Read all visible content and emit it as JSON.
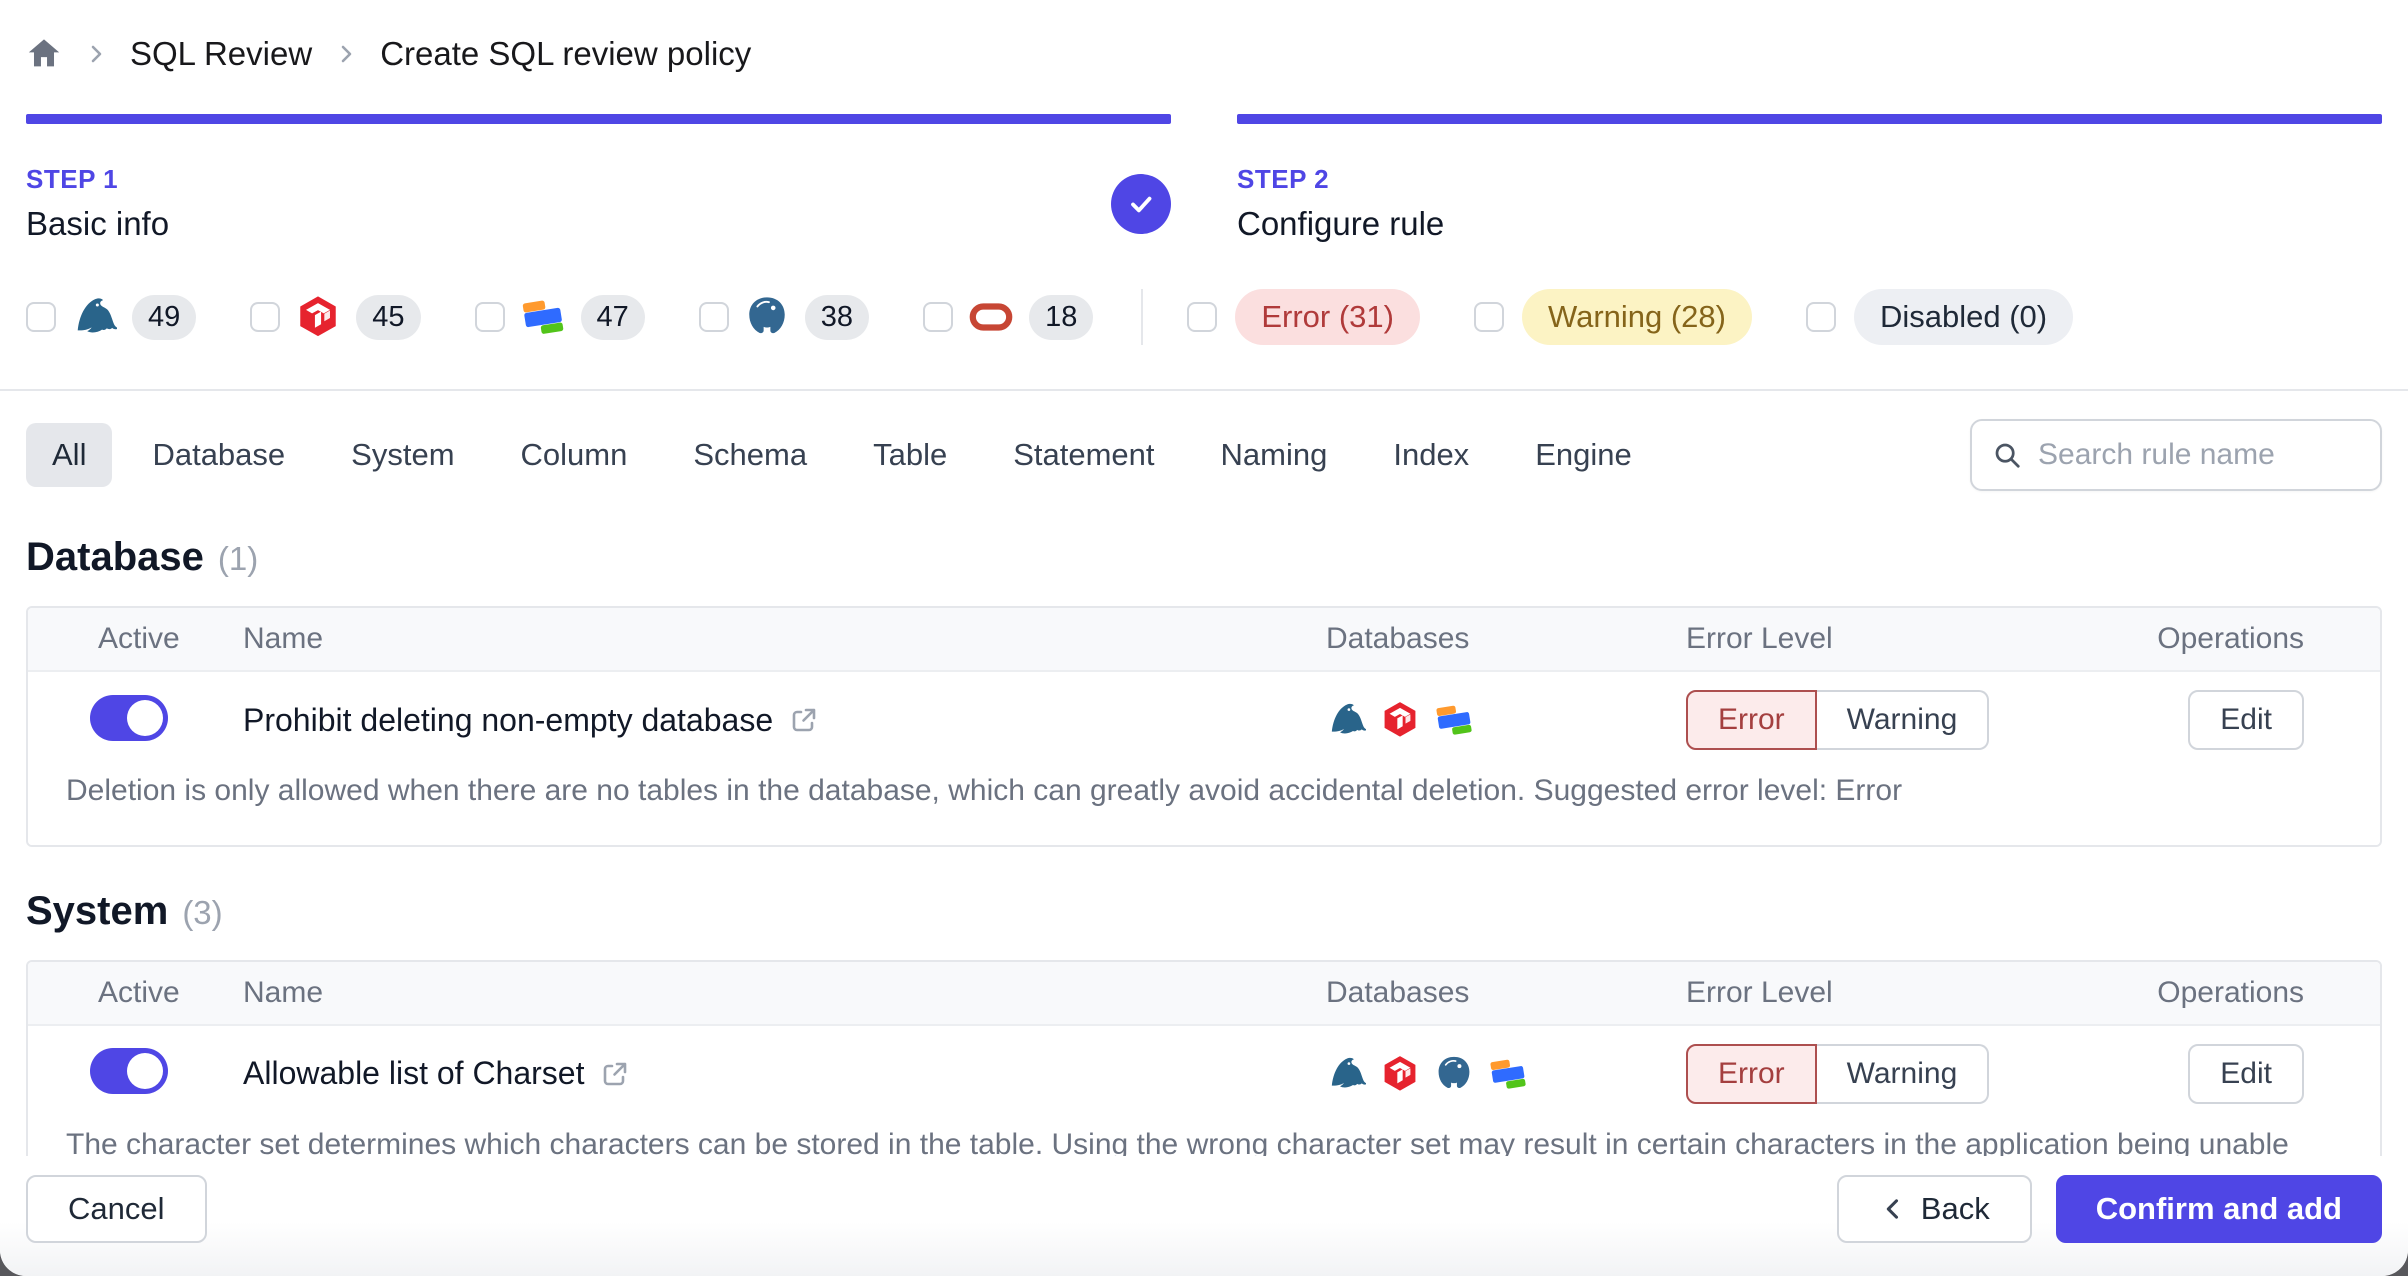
{
  "breadcrumb": {
    "items": [
      "SQL Review",
      "Create SQL review policy"
    ]
  },
  "steps": [
    {
      "label": "STEP 1",
      "title": "Basic info",
      "completed": true
    },
    {
      "label": "STEP 2",
      "title": "Configure rule",
      "completed": false
    }
  ],
  "filters": {
    "engines": [
      {
        "engine": "mysql",
        "count": 49,
        "checked": false
      },
      {
        "engine": "tidb",
        "count": 45,
        "checked": false
      },
      {
        "engine": "oceanbase",
        "count": 47,
        "checked": false
      },
      {
        "engine": "postgresql",
        "count": 38,
        "checked": false
      },
      {
        "engine": "oracle",
        "count": 18,
        "checked": false
      }
    ],
    "levels": [
      {
        "id": "error",
        "label": "Error (31)",
        "text_color": "#b03a3a",
        "bg_color": "#fbdfdf",
        "checked": false
      },
      {
        "id": "warning",
        "label": "Warning (28)",
        "text_color": "#85641a",
        "bg_color": "#fcf3c4",
        "checked": false
      },
      {
        "id": "disabled",
        "label": "Disabled (0)",
        "text_color": "#1f2937",
        "bg_color": "#edeff3",
        "checked": false
      }
    ]
  },
  "tabs": [
    {
      "label": "All",
      "active": true
    },
    {
      "label": "Database",
      "active": false
    },
    {
      "label": "System",
      "active": false
    },
    {
      "label": "Column",
      "active": false
    },
    {
      "label": "Schema",
      "active": false
    },
    {
      "label": "Table",
      "active": false
    },
    {
      "label": "Statement",
      "active": false
    },
    {
      "label": "Naming",
      "active": false
    },
    {
      "label": "Index",
      "active": false
    },
    {
      "label": "Engine",
      "active": false
    }
  ],
  "search": {
    "placeholder": "Search rule name"
  },
  "sections": [
    {
      "title": "Database",
      "count": "(1)",
      "columns": [
        "Active",
        "Name",
        "Databases",
        "Error Level",
        "Operations"
      ],
      "rules": [
        {
          "name": "Prohibit deleting non-empty database",
          "active": true,
          "engines": [
            "mysql",
            "tidb",
            "oceanbase"
          ],
          "level": "Error",
          "description": "Deletion is only allowed when there are no tables in the database, which can greatly avoid accidental deletion. Suggested error level: Error"
        }
      ]
    },
    {
      "title": "System",
      "count": "(3)",
      "columns": [
        "Active",
        "Name",
        "Databases",
        "Error Level",
        "Operations"
      ],
      "rules": [
        {
          "name": "Allowable list of Charset",
          "active": true,
          "engines": [
            "mysql",
            "tidb",
            "postgresql",
            "oceanbase"
          ],
          "level": "Error",
          "description": "The character set determines which characters can be stored in the table. Using the wrong character set may result in certain characters in the application being unable to be stored and displayed correctly, such as CJK and Emoji. Suggested error level: Error"
        }
      ]
    }
  ],
  "row_actions": {
    "error": "Error",
    "warning": "Warning",
    "edit": "Edit"
  },
  "footer": {
    "cancel": "Cancel",
    "back": "Back",
    "confirm": "Confirm and add"
  },
  "colors": {
    "accent": "#4f46e5",
    "error": "#b91c1c",
    "warning_bg": "#fcf3c4",
    "step_bar": "#4f46e5"
  }
}
